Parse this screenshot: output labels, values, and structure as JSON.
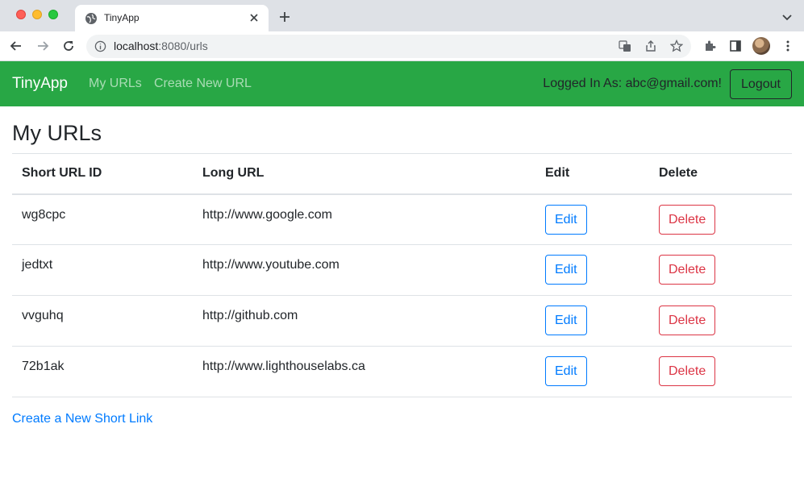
{
  "browser": {
    "tab_title": "TinyApp",
    "url_host": "localhost",
    "url_rest": ":8080/urls"
  },
  "navbar": {
    "brand": "TinyApp",
    "links": [
      "My URLs",
      "Create New URL"
    ],
    "logged_in_text": "Logged In As: abc@gmail.com!",
    "logout_label": "Logout"
  },
  "main": {
    "title": "My URLs",
    "columns": [
      "Short URL ID",
      "Long URL",
      "Edit",
      "Delete"
    ],
    "rows": [
      {
        "id": "wg8cpc",
        "url": "http://www.google.com",
        "edit": "Edit",
        "delete": "Delete"
      },
      {
        "id": "jedtxt",
        "url": "http://www.youtube.com",
        "edit": "Edit",
        "delete": "Delete"
      },
      {
        "id": "vvguhq",
        "url": "http://github.com",
        "edit": "Edit",
        "delete": "Delete"
      },
      {
        "id": "72b1ak",
        "url": "http://www.lighthouselabs.ca",
        "edit": "Edit",
        "delete": "Delete"
      }
    ],
    "create_link": "Create a New Short Link"
  },
  "colors": {
    "navbar": "#28a745",
    "edit": "#007bff",
    "delete": "#dc3545"
  }
}
